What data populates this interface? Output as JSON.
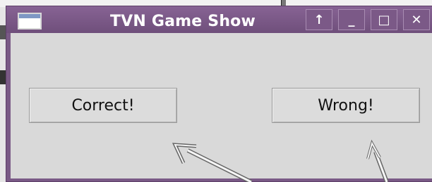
{
  "window": {
    "title": "TVN Game Show",
    "controls": {
      "up": "↑",
      "minimize": "_",
      "maximize": "□",
      "close": "✕"
    }
  },
  "buttons": {
    "correct": "Correct!",
    "wrong": "Wrong!"
  },
  "icons": [
    "app-window-icon",
    "arrow-up-icon",
    "minimize-icon",
    "maximize-icon",
    "close-icon",
    "pointer-arrow-icon"
  ]
}
